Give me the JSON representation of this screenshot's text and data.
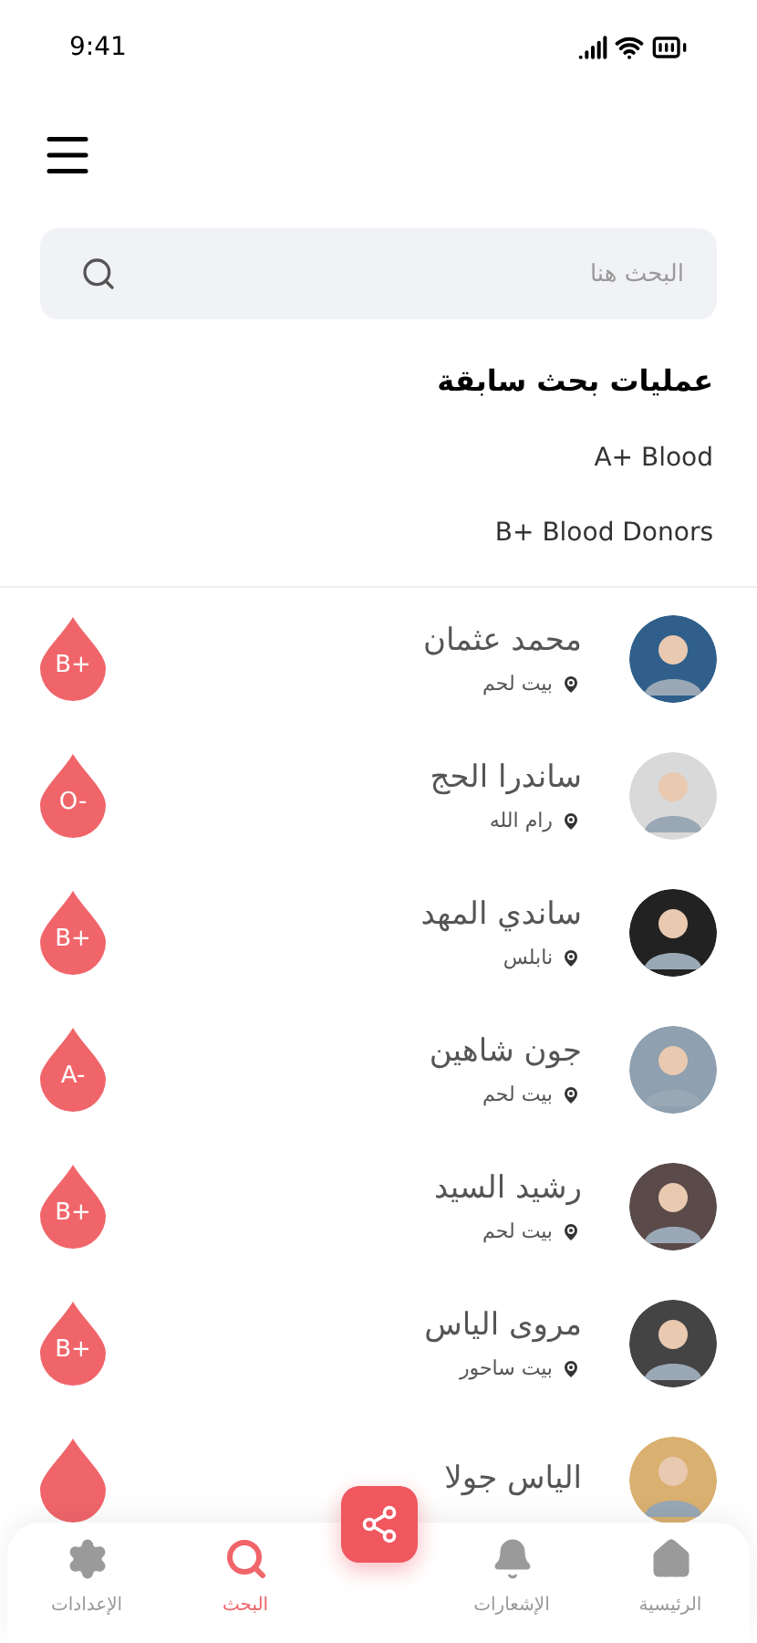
{
  "status_bar": {
    "time": "9:41"
  },
  "search": {
    "placeholder": "البحث هنا"
  },
  "recent": {
    "title": "عمليات بحث سابقة",
    "items": [
      "A+ Blood",
      "B+ Blood Donors"
    ]
  },
  "donors": [
    {
      "name": "محمد عثمان",
      "location": "بيت لحم",
      "blood": "B+",
      "color": "#2f5f8a"
    },
    {
      "name": "ساندرا الحج",
      "location": "رام الله",
      "blood": "O-",
      "color": "#d9d9d9"
    },
    {
      "name": "ساندي المهد",
      "location": "نابلس",
      "blood": "B+",
      "color": "#222222"
    },
    {
      "name": "جون شاهين",
      "location": "بيت لحم",
      "blood": "A-",
      "color": "#8fa0b0"
    },
    {
      "name": "رشيد السيد",
      "location": "بيت لحم",
      "blood": "B+",
      "color": "#5a4a4a"
    },
    {
      "name": "مروى الياس",
      "location": "بيت ساحور",
      "blood": "B+",
      "color": "#444444"
    },
    {
      "name": "الياس جولا",
      "color": "#d9b070"
    }
  ],
  "nav": [
    {
      "label": "الرئيسية",
      "kind": "home",
      "selected": false
    },
    {
      "label": "الإشعارات",
      "kind": "bell",
      "selected": false
    },
    {
      "kind": "share"
    },
    {
      "label": "البحث",
      "kind": "search",
      "selected": true
    },
    {
      "label": "الإعدادات",
      "kind": "gear",
      "selected": false
    }
  ]
}
